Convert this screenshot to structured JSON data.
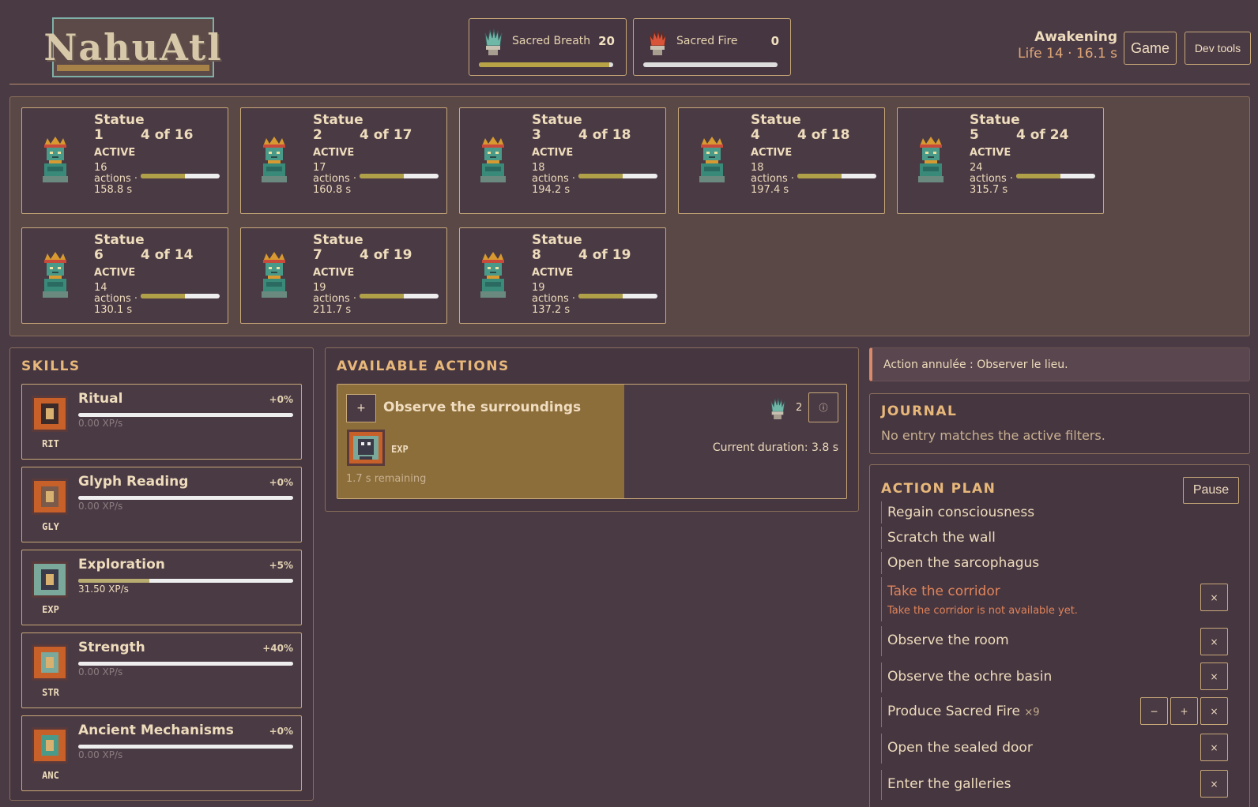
{
  "header": {
    "logo_text": "NahuAtl",
    "resources": [
      {
        "name": "Sacred Breath",
        "value": "20",
        "icon": "sacred-breath-icon",
        "progress": 1.0,
        "color": "#7fc0b0"
      },
      {
        "name": "Sacred Fire",
        "value": "0",
        "icon": "sacred-fire-icon",
        "progress": 0.0,
        "color": "#d86040"
      }
    ],
    "phase_title": "Awakening",
    "phase_sub": "Life 14 · 16.1 s",
    "game_button": "Game",
    "devtools_button": "Dev tools"
  },
  "statues": [
    {
      "name": "Statue 1",
      "count": "4 of 16",
      "status": "ACTIVE",
      "meta": "16 actions · 158.8 s",
      "progress": 0.56
    },
    {
      "name": "Statue 2",
      "count": "4 of 17",
      "status": "ACTIVE",
      "meta": "17 actions · 160.8 s",
      "progress": 0.56
    },
    {
      "name": "Statue 3",
      "count": "4 of 18",
      "status": "ACTIVE",
      "meta": "18 actions · 194.2 s",
      "progress": 0.56
    },
    {
      "name": "Statue 4",
      "count": "4 of 18",
      "status": "ACTIVE",
      "meta": "18 actions · 197.4 s",
      "progress": 0.56
    },
    {
      "name": "Statue 5",
      "count": "4 of 24",
      "status": "ACTIVE",
      "meta": "24 actions · 315.7 s",
      "progress": 0.56
    },
    {
      "name": "Statue 6",
      "count": "4 of 14",
      "status": "ACTIVE",
      "meta": "14 actions · 130.1 s",
      "progress": 0.56
    },
    {
      "name": "Statue 7",
      "count": "4 of 19",
      "status": "ACTIVE",
      "meta": "19 actions · 211.7 s",
      "progress": 0.56
    },
    {
      "name": "Statue 8",
      "count": "4 of 19",
      "status": "ACTIVE",
      "meta": "19 actions · 137.2 s",
      "progress": 0.56
    }
  ],
  "skills": {
    "title": "SKILLS",
    "items": [
      {
        "name": "Ritual",
        "abbr": "RIT",
        "pct": "+0%",
        "rate": "0.00 XP/s",
        "progress": 0.0,
        "icon": "ritual-icon"
      },
      {
        "name": "Glyph Reading",
        "abbr": "GLY",
        "pct": "+0%",
        "rate": "0.00 XP/s",
        "progress": 0.0,
        "icon": "glyph-reading-icon"
      },
      {
        "name": "Exploration",
        "abbr": "EXP",
        "pct": "+5%",
        "rate": "31.50 XP/s",
        "progress": 0.33,
        "icon": "exploration-icon"
      },
      {
        "name": "Strength",
        "abbr": "STR",
        "pct": "+40%",
        "rate": "0.00 XP/s",
        "progress": 0.0,
        "icon": "strength-icon"
      },
      {
        "name": "Ancient Mechanisms",
        "abbr": "ANC",
        "pct": "+0%",
        "rate": "0.00 XP/s",
        "progress": 0.0,
        "icon": "ancient-mechanisms-icon"
      }
    ]
  },
  "actions": {
    "title": "AVAILABLE ACTIONS",
    "add_label": "+",
    "name": "Observe the surroundings",
    "skill": "EXP",
    "remaining": "1.7 s remaining",
    "cost": "2",
    "info_label": "ⓘ",
    "duration": "Current duration: 3.8 s",
    "progress": 0.56
  },
  "notice": "Action annulée : Observer le lieu.",
  "journal": {
    "title": "JOURNAL",
    "empty": "No entry matches the active filters."
  },
  "plan": {
    "title": "ACTION PLAN",
    "pause": "Pause",
    "items": [
      {
        "label": "Regain consciousness"
      },
      {
        "label": "Scratch the wall"
      },
      {
        "label": "Open the sarcophagus"
      },
      {
        "label": "Take the corridor",
        "error": "Take the corridor is not available yet."
      },
      {
        "label": "Observe the room"
      },
      {
        "label": "Observe the ochre basin"
      },
      {
        "label": "Produce Sacred Fire",
        "mult": "×9"
      },
      {
        "label": "Open the sealed door"
      },
      {
        "label": "Enter the galleries"
      }
    ],
    "btn_remove": "×",
    "btn_minus": "−",
    "btn_plus": "+"
  }
}
